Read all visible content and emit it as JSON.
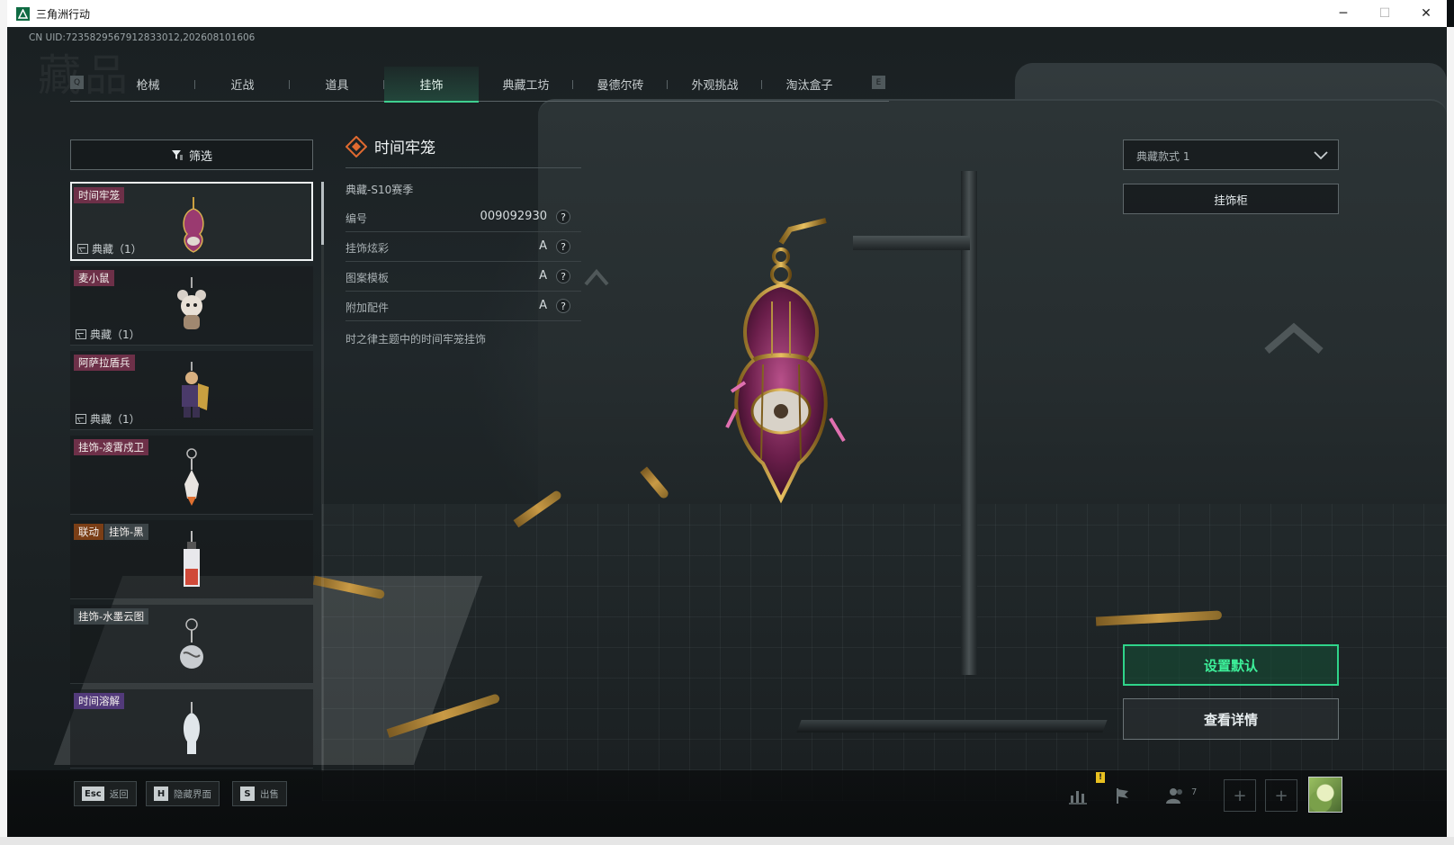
{
  "window": {
    "title": "三角洲行动",
    "controls": {
      "minimize": "─",
      "maximize": "☐",
      "close": "✕"
    }
  },
  "uid_line": "CN UID:7235829567912833012,202608101606",
  "watermark": "藏品",
  "tabs": {
    "prev_key": "Q",
    "next_key": "E",
    "items": [
      {
        "label": "枪械",
        "active": false
      },
      {
        "label": "近战",
        "active": false
      },
      {
        "label": "道具",
        "active": false
      },
      {
        "label": "挂饰",
        "active": true
      },
      {
        "label": "典藏工坊",
        "active": false
      },
      {
        "label": "曼德尔砖",
        "active": false
      },
      {
        "label": "外观挑战",
        "active": false
      },
      {
        "label": "淘汰盒子",
        "active": false
      }
    ]
  },
  "filter": {
    "label": "筛选"
  },
  "list": {
    "items": [
      {
        "name": "时间牢笼",
        "badge_color": "pink",
        "footer": "典藏（1）",
        "selected": true
      },
      {
        "name": "麦小鼠",
        "badge_color": "pink",
        "footer": "典藏（1）",
        "selected": false
      },
      {
        "name": "阿萨拉盾兵",
        "badge_color": "pink",
        "footer": "典藏（1）",
        "selected": false
      },
      {
        "name": "挂饰-凌霄戍卫",
        "badge_color": "pink",
        "footer": "",
        "selected": false
      },
      {
        "tag": "联动",
        "name": "挂饰-黑",
        "badge_color": "orange",
        "footer": "",
        "selected": false
      },
      {
        "name": "挂饰-水墨云图",
        "badge_color": "grey",
        "footer": "",
        "selected": false
      },
      {
        "name": "时间溶解",
        "badge_color": "purple",
        "footer": "",
        "selected": false
      }
    ]
  },
  "detail": {
    "title": "时间牢笼",
    "season": "典藏-S10赛季",
    "attributes": [
      {
        "label": "编号",
        "value": "009092930",
        "help": "?"
      },
      {
        "label": "挂饰炫彩",
        "value": "A",
        "help": "?"
      },
      {
        "label": "图案模板",
        "value": "A",
        "help": "?"
      },
      {
        "label": "附加配件",
        "value": "A",
        "help": "?"
      }
    ],
    "description": "时之律主题中的时间牢笼挂饰"
  },
  "right_panel": {
    "style_select": "典藏款式 1",
    "cabinet_button": "挂饰柜",
    "default_button": "设置默认",
    "details_button": "查看详情"
  },
  "bottom_bar": {
    "hotkeys": [
      {
        "key": "Esc",
        "label": "返回"
      },
      {
        "key": "H",
        "label": "隐藏界面"
      },
      {
        "key": "S",
        "label": "出售"
      }
    ],
    "warning_badge": "!",
    "friends_count": "7",
    "slot_symbol": "+"
  },
  "colors": {
    "accent_green": "#2fd48a",
    "badge_pink": "#6d3048",
    "badge_orange": "#7a3e16",
    "badge_purple": "#523a7a"
  }
}
